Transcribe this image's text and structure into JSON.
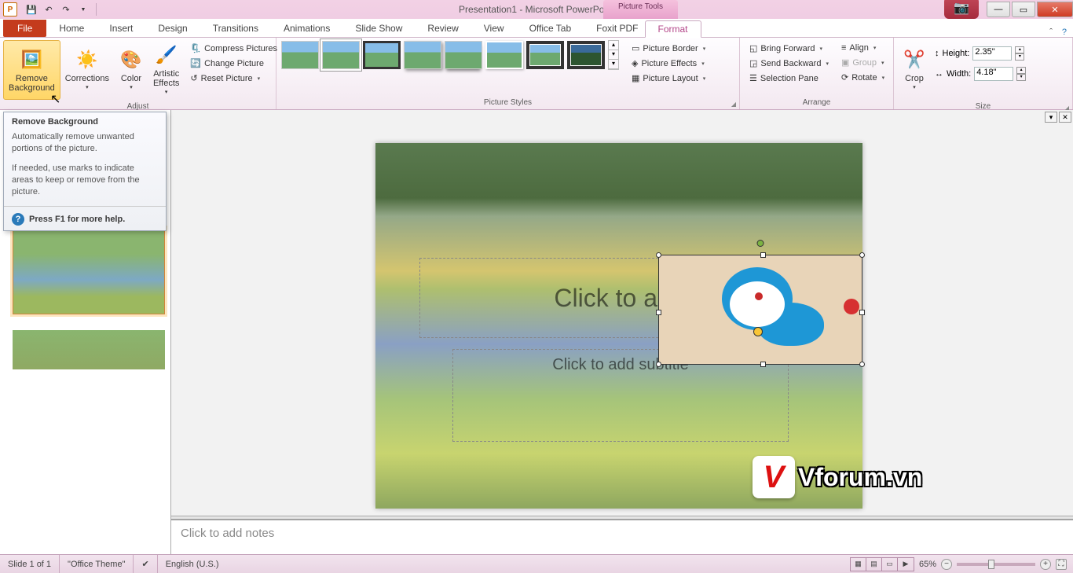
{
  "title": "Presentation1 - Microsoft PowerPoint",
  "contextualTab": "Picture Tools",
  "tabs": {
    "file": "File",
    "home": "Home",
    "insert": "Insert",
    "design": "Design",
    "transitions": "Transitions",
    "animations": "Animations",
    "slideshow": "Slide Show",
    "review": "Review",
    "view": "View",
    "officetab": "Office Tab",
    "foxit": "Foxit PDF",
    "format": "Format"
  },
  "ribbon": {
    "removeBg": "Remove\nBackground",
    "corrections": "Corrections",
    "color": "Color",
    "artistic": "Artistic\nEffects",
    "compress": "Compress Pictures",
    "changePic": "Change Picture",
    "resetPic": "Reset Picture",
    "groupAdjust": "Adjust",
    "groupStyles": "Picture Styles",
    "border": "Picture Border",
    "effects": "Picture Effects",
    "layout": "Picture Layout",
    "bringFwd": "Bring Forward",
    "sendBack": "Send Backward",
    "selPane": "Selection Pane",
    "align": "Align",
    "group": "Group",
    "rotate": "Rotate",
    "groupArrange": "Arrange",
    "crop": "Crop",
    "heightLabel": "Height:",
    "widthLabel": "Width:",
    "heightVal": "2.35\"",
    "widthVal": "4.18\"",
    "groupSize": "Size"
  },
  "tooltip": {
    "title": "Remove Background",
    "body1": "Automatically remove unwanted portions of the picture.",
    "body2": "If needed, use marks to indicate areas to keep or remove from the picture.",
    "help": "Press F1 for more help."
  },
  "slide": {
    "titlePlaceholder": "Click to add",
    "subtitlePlaceholder": "Click to add subtitle"
  },
  "notes": "Click to add notes",
  "watermark": "Vforum.vn",
  "status": {
    "slide": "Slide 1 of 1",
    "theme": "\"Office Theme\"",
    "lang": "English (U.S.)",
    "zoom": "65%"
  }
}
